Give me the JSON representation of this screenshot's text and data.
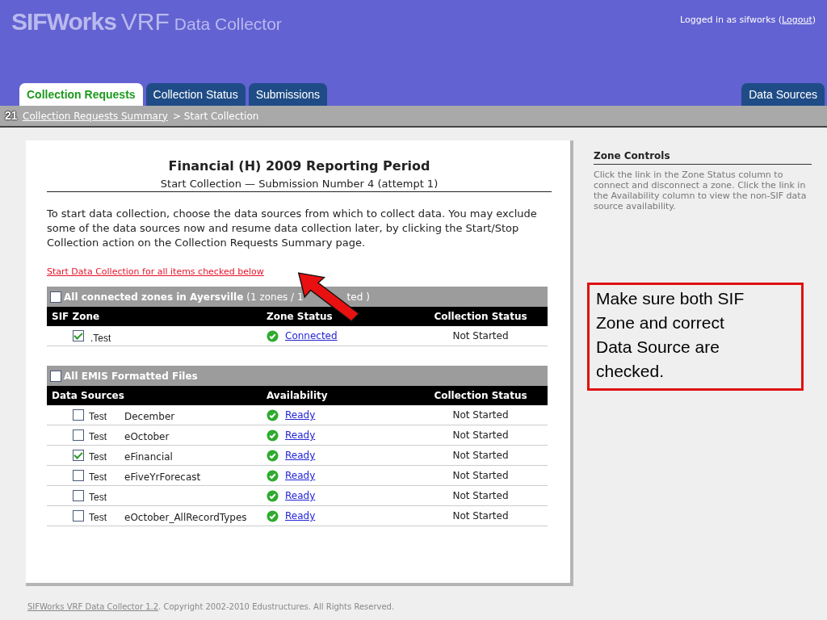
{
  "header": {
    "brand": "SIFWorks",
    "product": "VRF",
    "app": "Data Collector",
    "login_text": "Logged in as sifworks (",
    "logout": "Logout",
    "login_end": ")"
  },
  "tabs": [
    {
      "label": "Collection Requests",
      "selected": true
    },
    {
      "label": "Collection Status",
      "selected": false
    },
    {
      "label": "Submissions",
      "selected": false
    }
  ],
  "right_tab": {
    "label": "Data Sources",
    "selected": false
  },
  "breadcrumb": {
    "link": "Collection Requests Summary",
    "current": "> Start Collection"
  },
  "slide_number": "21",
  "main": {
    "title": "Financial (H) 2009 Reporting Period",
    "subtitle": "Start Collection — Submission Number 4 (attempt 1)",
    "intro": "To start data collection, choose the data sources from which to collect data. You may exclude some of the data sources now and resume data collection later, by clicking the Start/Stop Collection action on the Collection Requests Summary page.",
    "start_link": "Start Data Collection for all items checked below"
  },
  "zones": {
    "group_label": "All connected zones in Ayersville",
    "group_count_start": "(1 zones / 1",
    "group_count_end": "ted )",
    "group_checked": false,
    "columns": [
      "SIF Zone",
      "Zone Status",
      "Collection Status"
    ],
    "rows": [
      {
        "checked": true,
        "name": ".Test",
        "status": "Connected",
        "collection_status": "Not Started"
      }
    ]
  },
  "sources": {
    "group_label": "All EMIS Formatted Files",
    "group_checked": false,
    "columns": [
      "Data Sources",
      "Availability",
      "Collection Status"
    ],
    "rows": [
      {
        "checked": false,
        "source": "Test",
        "name": "December",
        "availability": "Ready",
        "collection_status": "Not Started"
      },
      {
        "checked": false,
        "source": "Test",
        "name": "eOctober",
        "availability": "Ready",
        "collection_status": "Not Started"
      },
      {
        "checked": true,
        "source": "Test",
        "name": "eFinancial",
        "availability": "Ready",
        "collection_status": "Not Started"
      },
      {
        "checked": false,
        "source": "Test",
        "name": "eFiveYrForecast",
        "availability": "Ready",
        "collection_status": "Not Started"
      },
      {
        "checked": false,
        "source": "Test",
        "availability": "Ready",
        "collection_status": "Not Started"
      },
      {
        "checked": false,
        "source": "Test",
        "name": "eOctober_AllRecordTypes",
        "availability": "Ready",
        "collection_status": "Not Started"
      }
    ]
  },
  "sidebar": {
    "title": "Zone Controls",
    "text": "Click the link in the Zone Status column to connect and disconnect a zone. Click the link in the Availability column to view the non-SIF data source availability."
  },
  "callout": "Make sure both SIF Zone and correct Data Source are checked.",
  "footer": {
    "link": "SIFWorks VRF Data Collector 1.2",
    "text": ". Copyright 2002-2010 Edustructures. All Rights Reserved."
  }
}
